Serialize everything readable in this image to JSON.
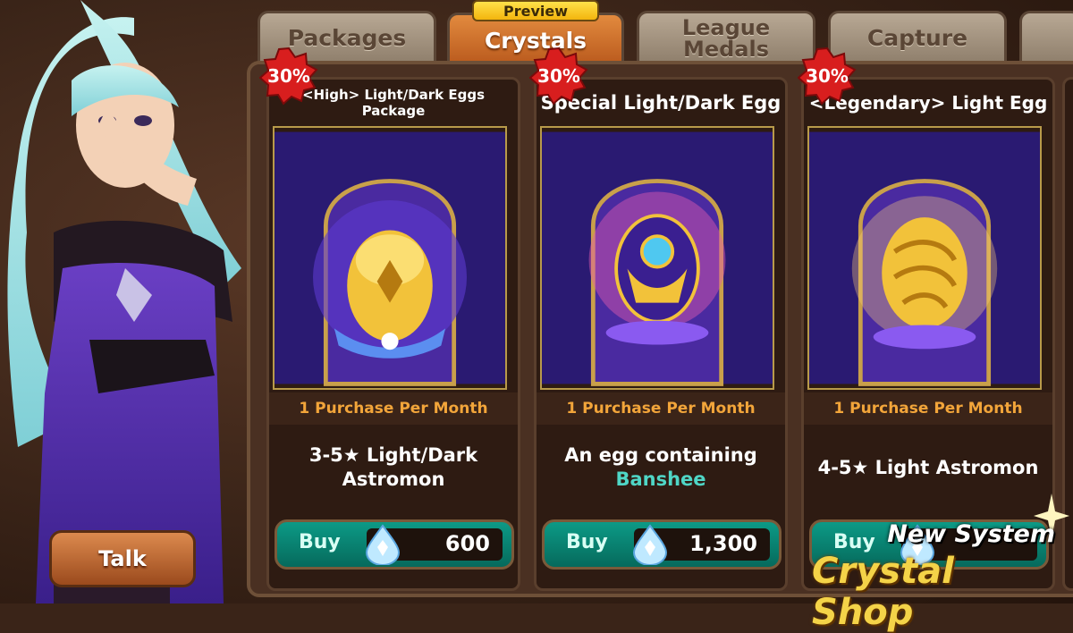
{
  "tabs": [
    {
      "label": "Packages",
      "active": false
    },
    {
      "label": "Crystals",
      "active": true
    },
    {
      "label_line1": "League",
      "label_line2": "Medals",
      "active": false
    },
    {
      "label": "Capture",
      "active": false
    }
  ],
  "preview_badge": "Preview",
  "talk_button": "Talk",
  "cards": [
    {
      "title": "<High> Light/Dark Eggs Package",
      "discount": "30%",
      "limit": "1 Purchase Per Month",
      "desc_line1": "3-5★ Light/Dark",
      "desc_line2": "Astromon",
      "buy_label": "Buy",
      "price": "600",
      "egg_icon": "golden-egg-icon"
    },
    {
      "title": "Special Light/Dark Egg",
      "discount": "30%",
      "limit": "1 Purchase Per Month",
      "desc_line1": "An egg containing",
      "desc_highlight": "Banshee",
      "buy_label": "Buy",
      "price": "1,300",
      "egg_icon": "emblem-egg-icon"
    },
    {
      "title": "<Legendary> Light Egg",
      "discount": "30%",
      "limit": "1 Purchase Per Month",
      "desc_line1": "4-5★ Light Astromon",
      "buy_label": "Buy",
      "price": "",
      "egg_icon": "gold-swirl-egg-icon"
    }
  ],
  "promo": {
    "subtitle": "New System",
    "title": "Crystal Shop"
  },
  "colors": {
    "active_tab": "#d6772f",
    "buy_button": "#0c8a78",
    "limit_text": "#f2a53a",
    "highlight": "#4fd6c6",
    "discount_badge": "#d81e1e"
  }
}
